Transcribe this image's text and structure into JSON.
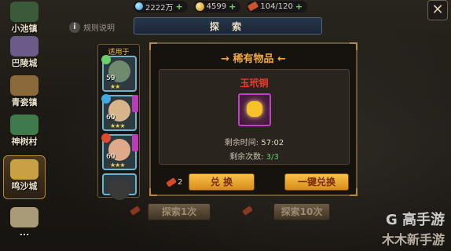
{
  "resources": {
    "gems": "2222万",
    "gold": "4599",
    "scrolls": "104/120"
  },
  "close_label": "✕",
  "cities": [
    {
      "name": "小池镇",
      "color": "#3a5b3a"
    },
    {
      "name": "巴陵城",
      "color": "#6a5b8a"
    },
    {
      "name": "青瓷镇",
      "color": "#8a6a3a"
    },
    {
      "name": "神树村",
      "color": "#3f7a4a"
    },
    {
      "name": "鸣沙城",
      "color": "#c9a043"
    },
    {
      "name": "...",
      "color": "#a99a78"
    }
  ],
  "hint": {
    "icon": "i",
    "text": "规则说明"
  },
  "banner_title": "探 索",
  "hero_panel": {
    "header": "适用于",
    "heroes": [
      {
        "level": "59",
        "stars": "★★",
        "face_color": "#6f8a6e",
        "elem_color": "#6ad16a"
      },
      {
        "level": "60",
        "stars": "★★★",
        "face_color": "#d8b48a",
        "elem_color": "#3fa9e0"
      },
      {
        "level": "60",
        "stars": "★★★",
        "face_color": "#e0a98a",
        "elem_color": "#e0492f"
      },
      {
        "level": "",
        "stars": "",
        "face_color": "#3a3a3a",
        "elem_color": "#3a3a3a"
      }
    ]
  },
  "rare": {
    "title": "→ 稀有物品 ←",
    "item_name": "玉玳铜",
    "time_label": "剩余时间: ",
    "time_value": "57:02",
    "count_label": "剩余次数: ",
    "count_value": "3/3"
  },
  "actions": {
    "cost": "2",
    "exchange_label": "兑 换",
    "one_key_label": "一键兑换",
    "explore1_label": "探索1次",
    "explore10_label": "探索10次"
  },
  "watermark": {
    "line1": "G 高手游",
    "line2": "木木新手游"
  }
}
